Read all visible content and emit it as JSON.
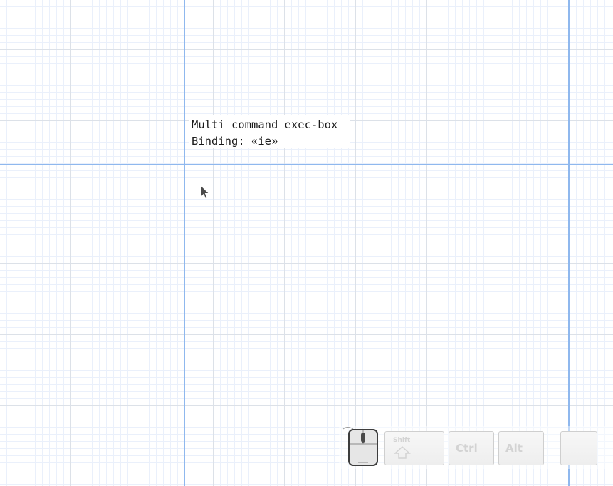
{
  "exec_box": {
    "line1": "Multi command exec-box",
    "line2": "Binding: «ie»"
  },
  "key_indicator": {
    "shift_label": "Shift",
    "ctrl_label": "Ctrl",
    "alt_label": "Alt"
  },
  "icons": {
    "cursor": "mouse-pointer-icon",
    "mouse": "mouse-icon",
    "shift_arrow": "shift-arrow-icon"
  },
  "colors": {
    "guide": "#8fb8ee",
    "grid_major": "#dce1e8",
    "grid_minor": "#eaf0fb",
    "key_text": "#d3d3d3"
  }
}
